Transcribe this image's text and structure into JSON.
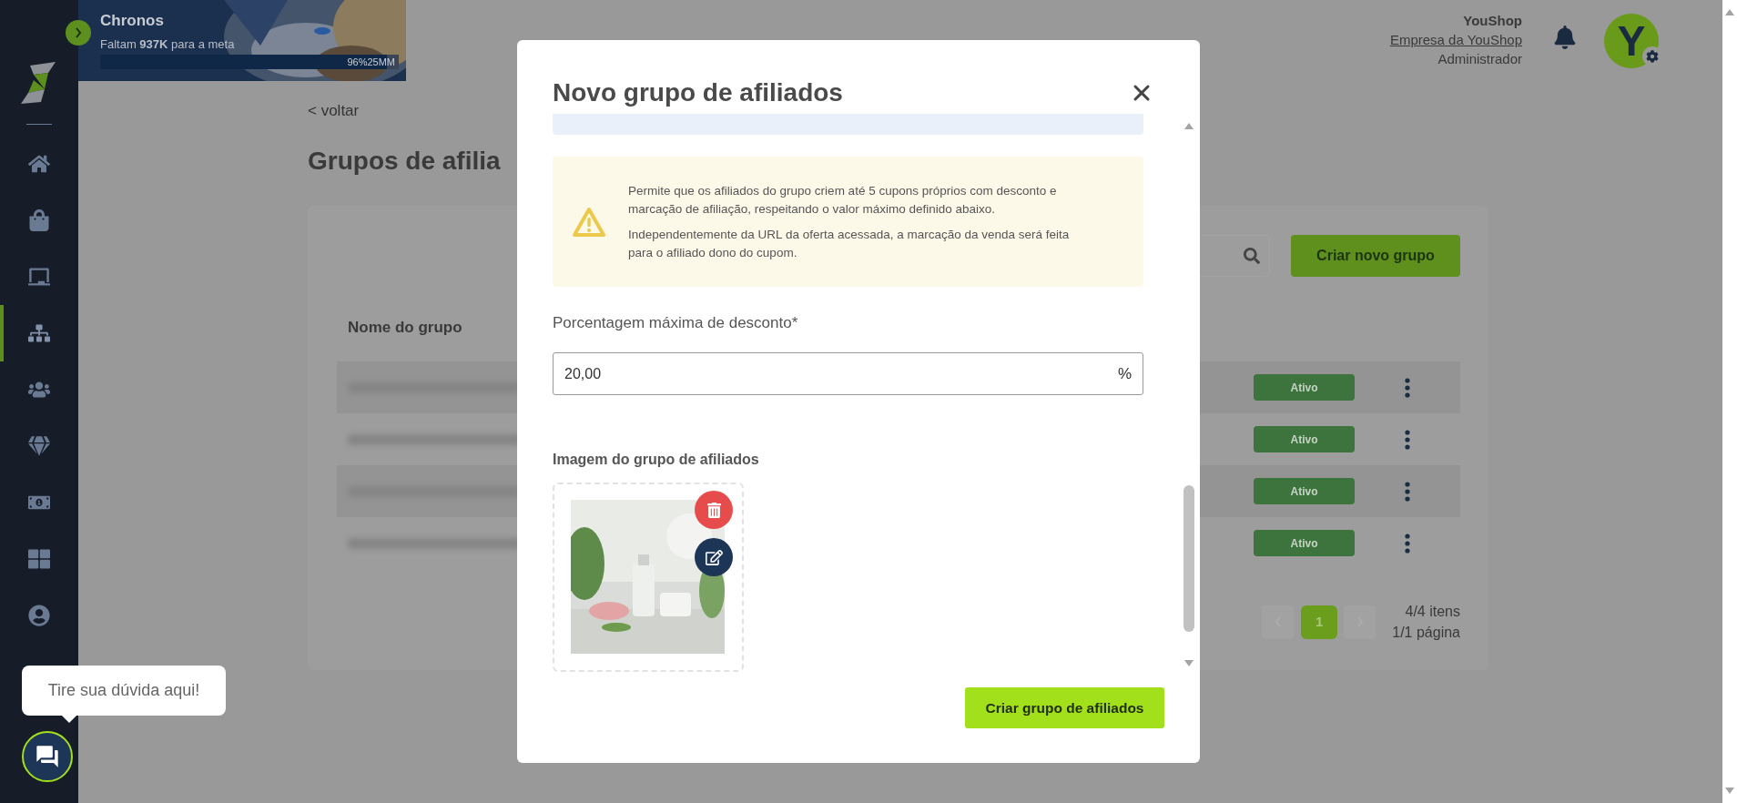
{
  "banner": {
    "title": "Chronos",
    "goal_text": "Faltam **937K** para a meta",
    "progress_label": "96%25MM",
    "level": 0.96
  },
  "user": {
    "name": "YouShop",
    "company": "Empresa da YouShop",
    "role": "Administrador",
    "avatar_letter": "Y"
  },
  "sidebar": {
    "items": [
      {
        "selected": false
      },
      {
        "selected": false
      },
      {
        "selected": false
      },
      {
        "selected": true
      },
      {
        "selected": false
      },
      {
        "selected": false
      },
      {
        "selected": false
      },
      {
        "selected": false
      },
      {
        "selected": false
      }
    ]
  },
  "page": {
    "back_link": "< voltar",
    "title": "Grupos de afilia",
    "create_button": "Criar novo grupo",
    "column": "Nome do grupo",
    "rows": [
      {
        "status": "Ativo"
      },
      {
        "status": "Ativo"
      },
      {
        "status": "Ativo"
      },
      {
        "status": "Ativo"
      }
    ],
    "pagination": {
      "pages": [
        {
          "label": "1",
          "selected": true
        }
      ],
      "items": "4/4 itens",
      "page_count": "1/1 página"
    }
  },
  "modal": {
    "title": "Novo grupo de afiliados",
    "notice": [
      "Permite que os afiliados do grupo criem até 5 cupons próprios com desconto e marcação de afiliação, respeitando o valor máximo definido abaixo.",
      "Independentemente da URL da oferta acessada, a marcação da venda será feita para o afiliado dono do cupom."
    ],
    "discount_label": "Porcentagem máxima de desconto*",
    "discount_value": "20,00",
    "discount_suffix": "%",
    "image_label": "Imagem do grupo de afiliados",
    "submit": "Criar grupo de afiliados"
  },
  "chat": {
    "tooltip": "Tire sua dúvida aqui!"
  }
}
